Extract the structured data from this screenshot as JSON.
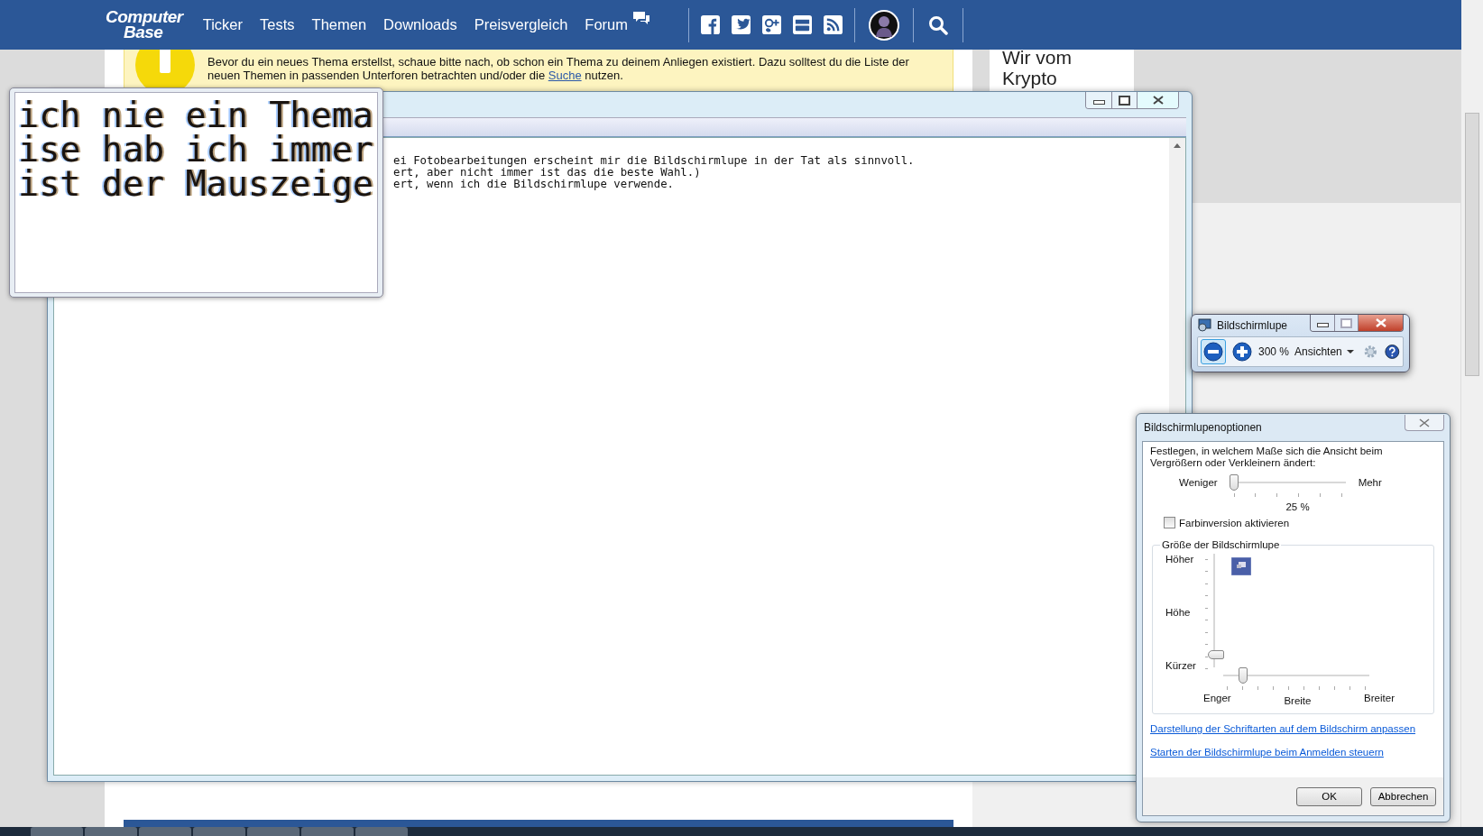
{
  "site_nav": {
    "logo": [
      "Computer",
      "Base"
    ],
    "items": [
      "Ticker",
      "Tests",
      "Themen",
      "Downloads",
      "Preisvergleich",
      "Forum"
    ]
  },
  "notice": {
    "text_before": "Bevor du ein neues Thema erstellst, schaue bitte nach, ob schon ein Thema zu deinem Anliegen existiert. Dazu solltest du die Liste der neuen Themen in passenden Unterforen betrachten und/oder die ",
    "link": "Suche",
    "text_after": " nutzen."
  },
  "sidebar": {
    "heading": "Wir vom Krypto"
  },
  "editor": {
    "lines": [
      "ei Fotobearbeitungen erscheint mir die Bildschirmlupe in der Tat als sinnvoll.",
      "ert, aber nicht immer ist das die beste Wahl.)",
      "ert, wenn ich die Bildschirmlupe verwende."
    ]
  },
  "magnifier_view": {
    "lines": [
      "ich nie ein Thema",
      "ise hab ich immer",
      "ist der Mauszeige"
    ]
  },
  "magnifier_toolbar": {
    "title": "Bildschirmlupe",
    "zoom": "300 %",
    "views": "Ansichten"
  },
  "options": {
    "title": "Bildschirmlupenoptionen",
    "description": "Festlegen, in welchem Maße sich die Ansicht beim Vergrößern oder Verkleinern ändert:",
    "zoom_step": {
      "less": "Weniger",
      "more": "Mehr",
      "level": 0,
      "reading": "25 %"
    },
    "color_inversion": {
      "label": "Farbinversion aktivieren",
      "checked": false
    },
    "size_group": {
      "title": "Größe der Bildschirmlupe",
      "higher": "Höher",
      "height": "Höhe",
      "shorter": "Kürzer",
      "height_slider": {
        "level": 0.11
      },
      "narrower": "Enger",
      "width": "Breite",
      "wider": "Breiter",
      "width_slider": {
        "level": 0.11
      }
    },
    "links": [
      "Darstellung der Schriftarten auf dem Bildschirm anpassen",
      "Starten der Bildschirmlupe beim Anmelden steuern"
    ],
    "buttons": [
      "OK",
      "Abbrechen"
    ]
  }
}
